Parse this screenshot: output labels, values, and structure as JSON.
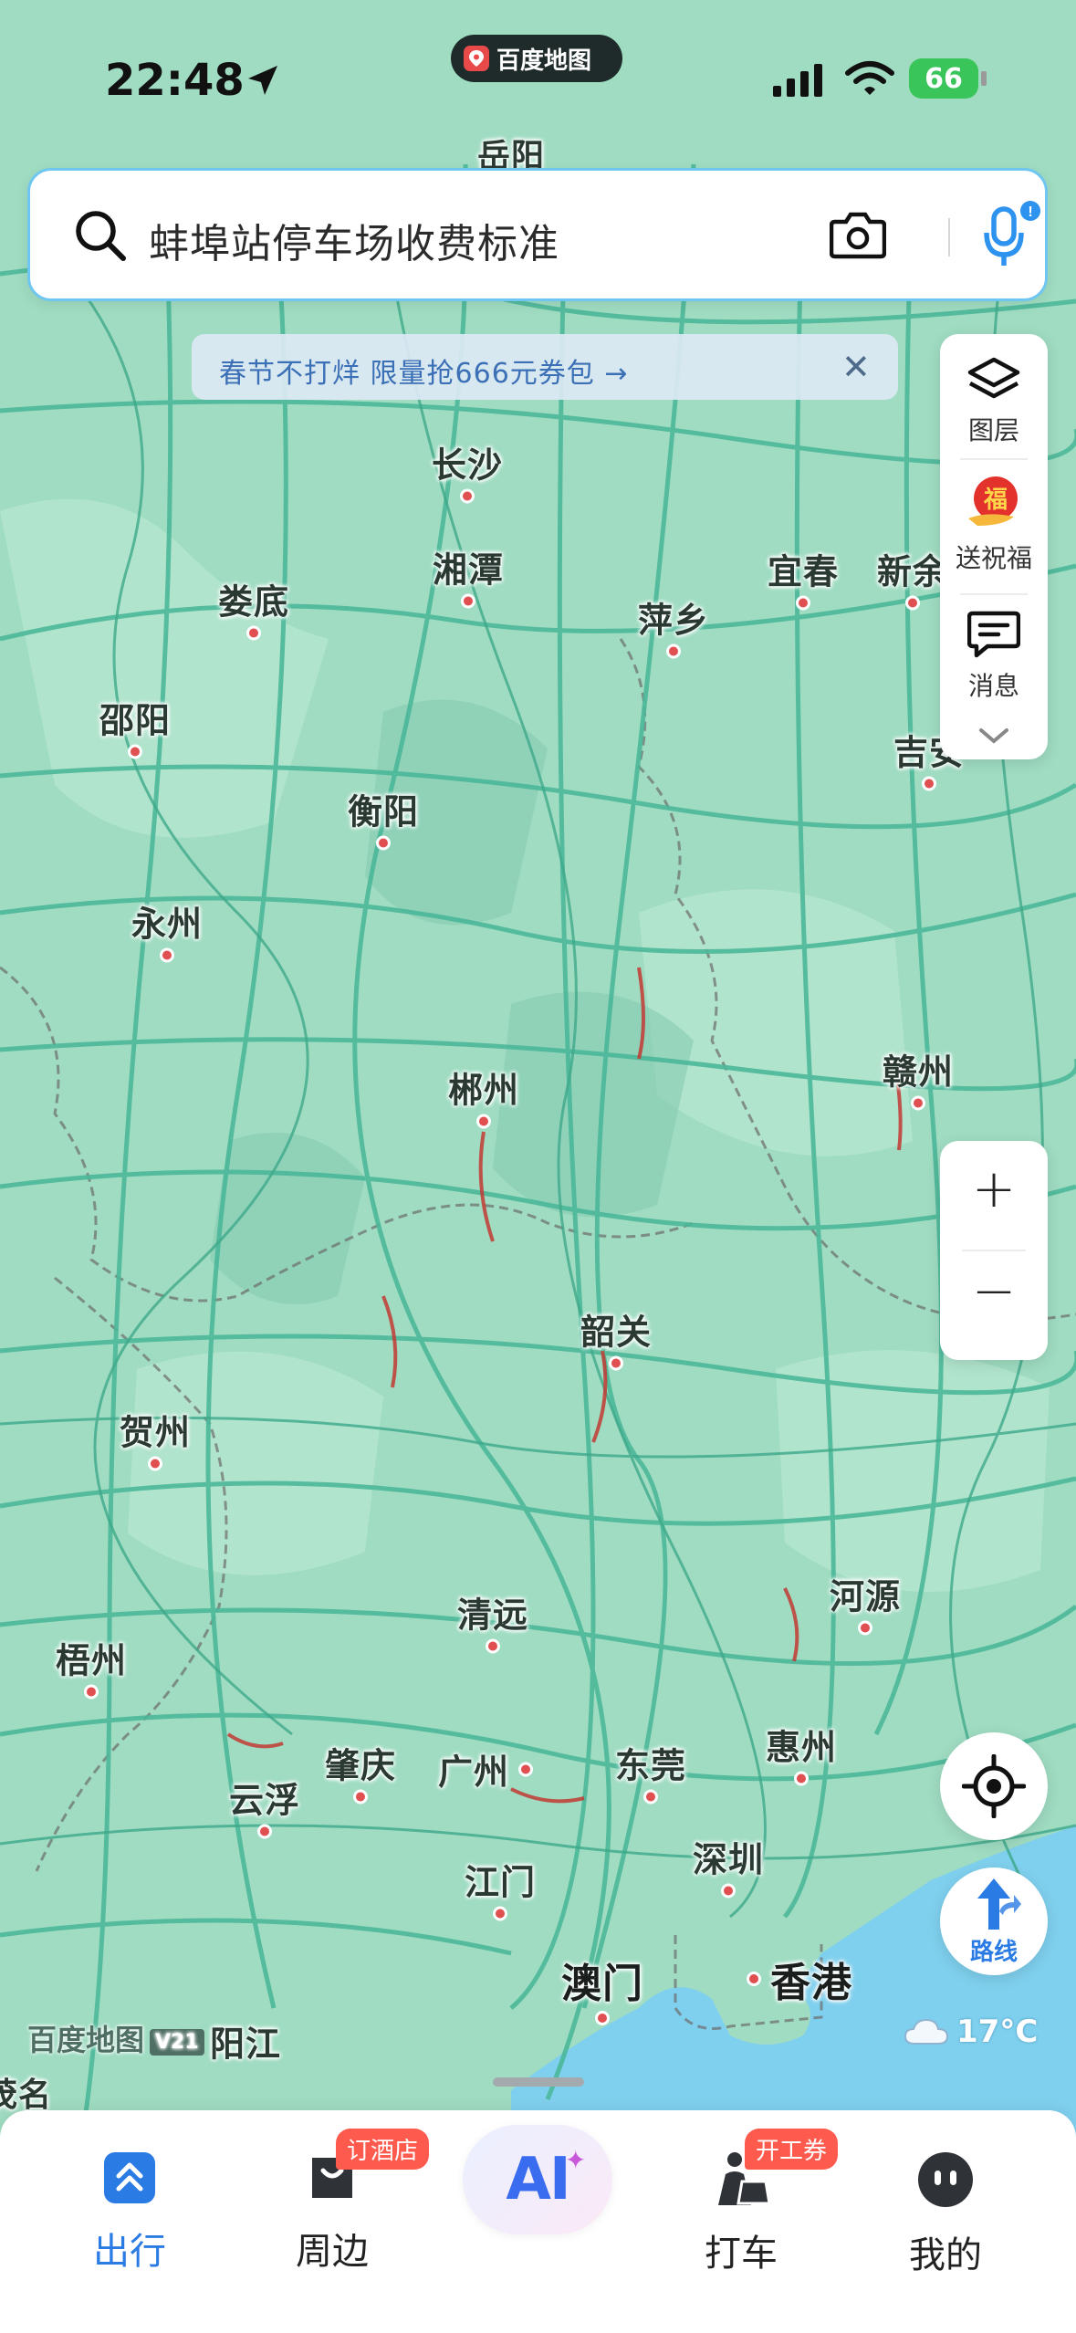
{
  "status_bar": {
    "time": "22:48",
    "app_pill": "百度地图",
    "battery": "66"
  },
  "search": {
    "placeholder": "蚌埠站停车场收费标准",
    "icons": [
      "search-icon",
      "camera-icon",
      "mic-icon"
    ]
  },
  "promo": {
    "text": "春节不打烊 限量抢666元券包 →",
    "close": "✕"
  },
  "right_toolbar": {
    "layers": "图层",
    "blessing": "送祝福",
    "messages": "消息"
  },
  "map": {
    "cities": [
      {
        "id": "changsha",
        "name": "长沙"
      },
      {
        "id": "xiangtan",
        "name": "湘潭"
      },
      {
        "id": "loudi",
        "name": "娄底"
      },
      {
        "id": "shaoyang",
        "name": "邵阳"
      },
      {
        "id": "hengyang",
        "name": "衡阳"
      },
      {
        "id": "yongzhou",
        "name": "永州"
      },
      {
        "id": "chenzhou",
        "name": "郴州"
      },
      {
        "id": "pingxiang",
        "name": "萍乡"
      },
      {
        "id": "yichun",
        "name": "宜春"
      },
      {
        "id": "xinyu",
        "name": "新余"
      },
      {
        "id": "jian",
        "name": "吉安"
      },
      {
        "id": "ganzhou",
        "name": "赣州"
      },
      {
        "id": "shaoguan",
        "name": "韶关"
      },
      {
        "id": "hezhou",
        "name": "贺州"
      },
      {
        "id": "qingyuan",
        "name": "清远"
      },
      {
        "id": "heyuan",
        "name": "河源"
      },
      {
        "id": "wuzhou",
        "name": "梧州"
      },
      {
        "id": "zhaoqing",
        "name": "肇庆"
      },
      {
        "id": "yunfu",
        "name": "云浮"
      },
      {
        "id": "guangzhou",
        "name": "广州"
      },
      {
        "id": "dongguan",
        "name": "东莞"
      },
      {
        "id": "huizhou",
        "name": "惠州"
      },
      {
        "id": "jiangmen",
        "name": "江门"
      },
      {
        "id": "shenzhen",
        "name": "深圳"
      },
      {
        "id": "macau",
        "name": "澳门"
      },
      {
        "id": "hongkong",
        "name": "香港"
      },
      {
        "id": "yangjiang",
        "name": "阳江"
      },
      {
        "id": "maoming",
        "name": "茂名"
      },
      {
        "id": "yueyang",
        "name": "岳阳"
      }
    ],
    "watermark": "百度地图",
    "watermark_version": "V21",
    "weather": "17°C",
    "colors": {
      "land": "#9fdcc2",
      "road": "#4cb89a",
      "sea": "#7fd0ee",
      "dot": "#e05050"
    }
  },
  "controls": {
    "zoom_in": "+",
    "zoom_out": "−",
    "route": "路线"
  },
  "tabbar": {
    "tabs": [
      {
        "label": "出行"
      },
      {
        "label": "周边",
        "tag": "订酒店"
      },
      {
        "label": "打车",
        "tag": "开工券"
      },
      {
        "label": "我的"
      }
    ],
    "ai": "AI"
  }
}
